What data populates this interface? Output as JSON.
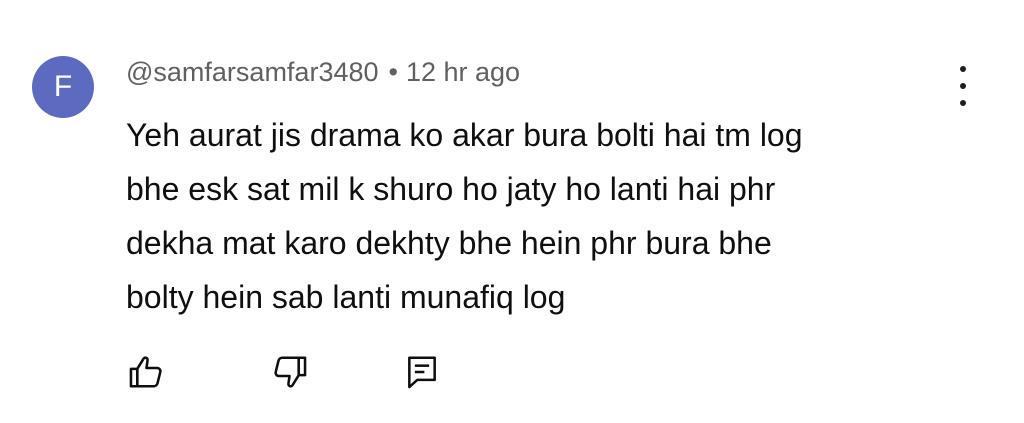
{
  "comment": {
    "avatar_letter": "F",
    "avatar_color": "#5c6bc0",
    "author": "@samfarsamfar3480",
    "separator": "•",
    "time": "12 hr ago",
    "text_lines": [
      "Yeh aurat jis drama ko akar bura bolti hai tm log",
      "bhe esk sat mil k shuro ho jaty ho lanti hai phr",
      "dekha mat karo dekhty bhe hein phr bura bhe",
      "bolty hein sab lanti munafiq log"
    ],
    "actions": {
      "like_icon": "thumbs-up-icon",
      "dislike_icon": "thumbs-down-icon",
      "reply_icon": "reply-icon",
      "menu_icon": "more-vertical-icon"
    }
  }
}
